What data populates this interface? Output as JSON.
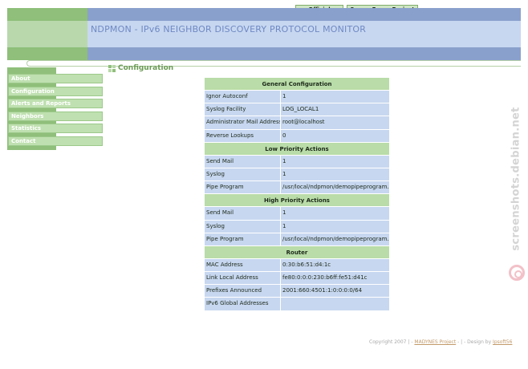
{
  "top_links": {
    "official": "Official Website",
    "sourceforge": "SourceForge Project Page"
  },
  "header": {
    "title": "NDPMON - IPv6 NEIGHBOR DISCOVERY PROTOCOL MONITOR"
  },
  "sidebar": {
    "items": [
      {
        "label": "About"
      },
      {
        "label": "Configuration"
      },
      {
        "label": "Alerts and Reports"
      },
      {
        "label": "Neighbors"
      },
      {
        "label": "Statistics"
      },
      {
        "label": "Contact"
      }
    ]
  },
  "page": {
    "heading": "Configuration"
  },
  "config": {
    "general": {
      "title": "General Configuration",
      "rows": [
        {
          "k": "Ignor Autoconf",
          "v": "1"
        },
        {
          "k": "Syslog Facility",
          "v": "LOG_LOCAL1"
        },
        {
          "k": "Administrator Mail Address",
          "v": "root@localhost"
        },
        {
          "k": "Reverse Lookups",
          "v": "0"
        }
      ]
    },
    "low": {
      "title": "Low Priority Actions",
      "rows": [
        {
          "k": "Send Mail",
          "v": "1"
        },
        {
          "k": "Syslog",
          "v": "1"
        },
        {
          "k": "Pipe Program",
          "v": "/usr/local/ndpmon/demopipeprogram.pl"
        }
      ]
    },
    "high": {
      "title": "High Priority Actions",
      "rows": [
        {
          "k": "Send Mail",
          "v": "1"
        },
        {
          "k": "Syslog",
          "v": "1"
        },
        {
          "k": "Pipe Program",
          "v": "/usr/local/ndpmon/demopipeprogram.pl"
        }
      ]
    },
    "router": {
      "title": "Router",
      "rows": [
        {
          "k": "MAC Address",
          "v": "0:30:b6:51:d4:1c"
        },
        {
          "k": "Link Local Address",
          "v": "fe80:0:0:0:230:b6ff:fe51:d41c"
        },
        {
          "k": "Prefixes Announced",
          "v": "2001:660:4501:1:0:0:0:0/64"
        },
        {
          "k": "IPv6 Global Addresses",
          "v": ""
        }
      ]
    }
  },
  "footer": {
    "prefix": "Copyright 2007 | - ",
    "link1": "MADYNES Project",
    "mid": " - | - Design by ",
    "link2": "Ipsoft56"
  },
  "watermark": {
    "text": "screenshots.debian.net"
  },
  "colors": {
    "green": "#8fbf7a",
    "blue": "#8aa0cc",
    "light_blue": "#c7d7f0",
    "section_green": "#b9dca8"
  }
}
